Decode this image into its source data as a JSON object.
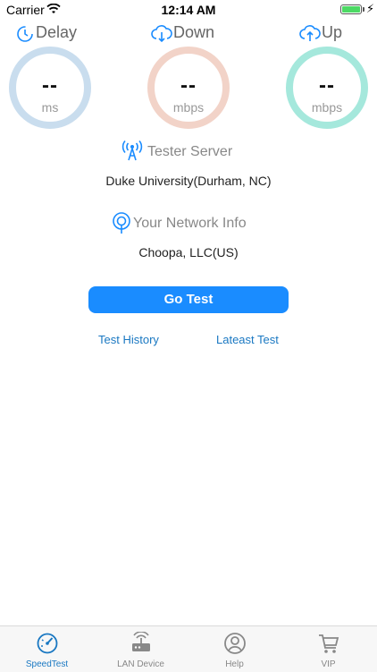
{
  "status_bar": {
    "carrier": "Carrier",
    "time": "12:14 AM"
  },
  "metrics": [
    {
      "title": "Delay",
      "value": "--",
      "unit": "ms",
      "color": "#c9ddee",
      "icon": "timer-icon"
    },
    {
      "title": "Down",
      "value": "--",
      "unit": "mbps",
      "color": "#f2d3c8",
      "icon": "cloud-download-icon"
    },
    {
      "title": "Up",
      "value": "--",
      "unit": "mbps",
      "color": "#a5e8dc",
      "icon": "cloud-upload-icon"
    }
  ],
  "server": {
    "title": "Tester Server",
    "value": "Duke University(Durham, NC)",
    "icon": "antenna-icon"
  },
  "network": {
    "title": "Your Network Info",
    "value": "Choopa, LLC(US)",
    "icon": "location-pin-icon"
  },
  "go_button_label": "Go Test",
  "links": {
    "history": "Test History",
    "latest": "Lateast Test"
  },
  "tabs": [
    {
      "label": "SpeedTest",
      "icon": "speedometer-icon",
      "active": true
    },
    {
      "label": "LAN Device",
      "icon": "router-icon",
      "active": false
    },
    {
      "label": "Help",
      "icon": "help-user-icon",
      "active": false
    },
    {
      "label": "VIP",
      "icon": "cart-icon",
      "active": false
    }
  ],
  "colors": {
    "accent": "#1a8cff",
    "link": "#1a78c2"
  }
}
